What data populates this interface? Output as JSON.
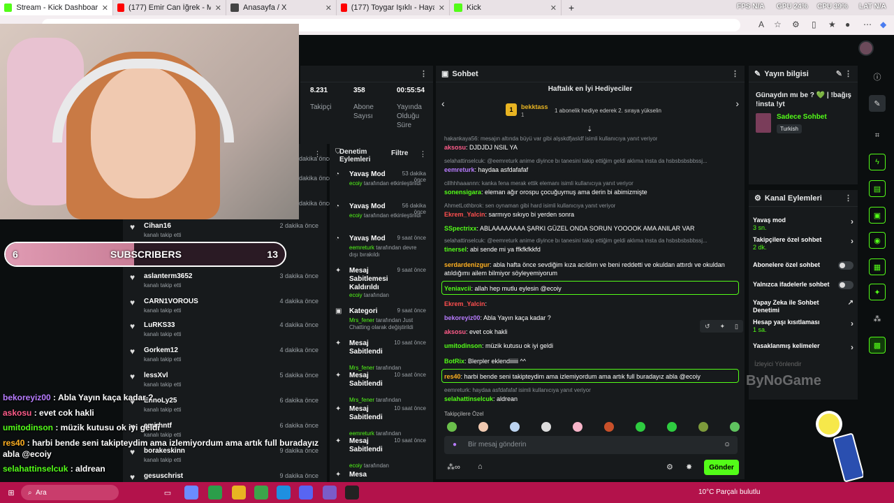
{
  "tabs": [
    {
      "label": "Stream - Kick Dashboard",
      "color": "#53fc18"
    },
    {
      "label": "(177) Emir Can İğrek - Müzik",
      "color": "#ff0000"
    },
    {
      "label": "Anasayfa / X",
      "color": "#444444"
    },
    {
      "label": "(177) Toygar Işıklı - Hayat Gibi (O",
      "color": "#ff0000"
    },
    {
      "label": "Kick",
      "color": "#53fc18"
    }
  ],
  "hud": {
    "fps": "FPS N/A",
    "gpu": "GPU 24%",
    "cpu": "CPU 39%",
    "lat": "LAT N/A"
  },
  "stats": [
    {
      "value": "8.231",
      "label": "Takipçi"
    },
    {
      "value": "358",
      "label": "Abone Sayısı"
    },
    {
      "value": "00:55:54",
      "label": "Yayında Olduğu Süre"
    }
  ],
  "subgoal": {
    "current": "6",
    "label": "SUBSCRIBERS",
    "target": "13",
    "progress": 0.46
  },
  "followers": [
    {
      "name": "Cihan16",
      "sub": "kanalı takip etti",
      "time": "2 dakika önce"
    },
    {
      "name": "aslanterm3652",
      "sub": "kanalı takip etti",
      "time": "3 dakika önce"
    },
    {
      "name": "CARN1VOROUS",
      "sub": "kanalı takip etti",
      "time": "4 dakika önce"
    },
    {
      "name": "LuRKS33",
      "sub": "kanalı takip etti",
      "time": "4 dakika önce"
    },
    {
      "name": "Gorkem12",
      "sub": "kanalı takip etti",
      "time": "4 dakika önce"
    },
    {
      "name": "lessXvl",
      "sub": "kanalı takip etti",
      "time": "5 dakika önce"
    },
    {
      "name": "EnnoLy25",
      "sub": "kanalı takip etti",
      "time": "6 dakika önce"
    },
    {
      "name": "emirhntf",
      "sub": "kanalı takip etti",
      "time": "6 dakika önce"
    },
    {
      "name": "borakeskinn",
      "sub": "kanalı takip etti",
      "time": "9 dakika önce"
    },
    {
      "name": "gesuschrist",
      "sub": "",
      "time": "9 dakika önce"
    }
  ],
  "follower_times_top": [
    "dakika önce",
    "dakika önce",
    "dakika önce"
  ],
  "overlay_chat": [
    {
      "user": "bekoreyiz00",
      "color": "#b87cff",
      "text": " : Abla Yayın kaça kadar ?"
    },
    {
      "user": "askosu",
      "color": "#ff5c8a",
      "text": " : evet cok hakli"
    },
    {
      "user": "umitodinson",
      "color": "#53fc18",
      "text": " : müzik kutusu ok iyi geldi"
    },
    {
      "user": "res40",
      "color": "#ffb020",
      "text": " : harbi bende seni takipteydim ama izlemiyordum ama artık full buradayız"
    },
    {
      "user": "",
      "color": "#ffffff",
      "text": "abla @ecoiy"
    },
    {
      "user": "selahattinselcuk",
      "color": "#53fc18",
      "text": " : aldrean"
    }
  ],
  "mod": {
    "title": "Denetim Eylemleri",
    "filter": "Filtre",
    "items": [
      {
        "title": "Yavaş Mod",
        "time": "53 dakika önce",
        "user": "ecoiy",
        "desc": " tarafından etkinleştirildi"
      },
      {
        "title": "Yavaş Mod",
        "time": "56 dakika önce",
        "user": "ecoiy",
        "desc": " tarafından etkinleştirildi"
      },
      {
        "title": "Yavaş Mod",
        "time": "9 saat önce",
        "user": "eemreturk",
        "desc": " tarafından devre dışı bırakıldı"
      },
      {
        "title": "Mesaj Sabitlemesi Kaldırıldı",
        "time": "9 saat önce",
        "user": "ecoiy",
        "desc": " tarafından"
      },
      {
        "title": "Kategori",
        "time": "9 saat önce",
        "user": "Mrs_fener",
        "desc": " tarafından Just Chatting olarak değiştirildi"
      },
      {
        "title": "Mesaj Sabitlendi",
        "time": "10 saat önce",
        "user": "Mrs_fener",
        "desc": " tarafından"
      },
      {
        "title": "Mesaj Sabitlendi",
        "time": "10 saat önce",
        "user": "Mrs_fener",
        "desc": " tarafından"
      },
      {
        "title": "Mesaj Sabitlendi",
        "time": "10 saat önce",
        "user": "eemreturk",
        "desc": " tarafından"
      },
      {
        "title": "Mesaj Sabitlendi",
        "time": "10 saat önce",
        "user": "ecoiy",
        "desc": " tarafından"
      },
      {
        "title": "Mesa",
        "time": "",
        "user": "",
        "desc": ""
      }
    ]
  },
  "chat": {
    "title": "Sohbet",
    "gifter_title": "Haftalık en İyi Hediyeciler",
    "gifter_name": "bekktass",
    "gifter_rank": "1",
    "gifter_count": "1",
    "gifter_note": "1 abonelik hediye ederek 2. sıraya yükselin",
    "messages": [
      {
        "reply": "hakankaya56: mesajın altında büyü var gibi alşskdfjasldf isimli kullanıcıya yanıt veriyor"
      },
      {
        "user": "aksosu",
        "color": "#ff5c8a",
        "text": ": DJDJDJ NSIL YA"
      },
      {
        "reply": "selahattinselcuk: @eemreturk anime diyince bı tanesini takip ettiğim geldi aklıma insta da hsbsbsbsbbssj..."
      },
      {
        "user": "eemreturk",
        "color": "#b87cff",
        "text": ": haydaa asfdafafaf"
      },
      {
        "reply": "cillhhhaaannn: kanka fena merak ettik elemanı isimli kullanıcıya yanıt veriyor"
      },
      {
        "user": "sonensigara",
        "color": "#53fc18",
        "text": ": eleman ağır orospu çocuğuymuş ama derin bi abimizmişte"
      },
      {
        "reply": "AhmetLothbrok: sen oynaman gibi hard isimli kullanıcıya yanıt veriyor"
      },
      {
        "user": "Ekrem_Yalcin",
        "color": "#ff4f4f",
        "text": ": sarmıyo sıkıyo bi yerden sonra"
      },
      {
        "user": "SSpectrixx",
        "color": "#53fc18",
        "text": ": ABLAAAAAAAA ŞARKI GÜZEL ONDA SORUN YOOOOK AMA ANILAR VAR"
      },
      {
        "reply": "selahattinselcuk: @eemreturk anime diyince bı tanesini takip ettiğim geldi aklıma insta da hsbsbsbsbbssj..."
      },
      {
        "user": "tinersel",
        "color": "#53fc18",
        "text": ": abi sende mi ya ffkfkfkkfd"
      },
      {
        "user": "serdardenizgur",
        "color": "#ffb020",
        "text": ": abla hafta önce sevdiğim kıza acıldım ve beni reddetti ve okuldan attırdı ve okuldan"
      },
      {
        "user": "",
        "color": "#ffffff",
        "text": "atıldığımı ailem bilmiyor söyleyemiyorum"
      },
      {
        "user": "Yeniavcii",
        "color": "#53fc18",
        "text": ": allah hep mutlu eylesin @ecoiy"
      },
      {
        "user": "Ekrem_Yalcin",
        "color": "#ff4f4f",
        "text": ":"
      },
      {
        "user": "bekoreyiz00",
        "color": "#b87cff",
        "text": ": Abla Yayın kaça kadar ?"
      },
      {
        "user": "aksosu",
        "color": "#ff5c8a",
        "text": ": evet cok hakli"
      },
      {
        "user": "umitodinson",
        "color": "#53fc18",
        "text": ": müzik kutusu ok iyi geldi"
      },
      {
        "user": "BotRix",
        "color": "#53fc18",
        "text": ": Blerpler eklendiiiiii ^^"
      },
      {
        "user": "res40",
        "color": "#ffb020",
        "text": ": harbi bende seni takipteydim ama izlemiyordum ama artık full buradayız abla @ecoiy"
      },
      {
        "reply": "eemreturk: haydaa asfdafafaf isimli kullanıcıya yanıt veriyor"
      },
      {
        "user": "selahattinselcuk",
        "color": "#53fc18",
        "text": ": aldrean"
      }
    ],
    "emote_label": "Takipçilere Özel",
    "input_placeholder": "Bir mesaj gönderin",
    "send_label": "Gönder"
  },
  "info": {
    "title": "Yayın bilgisi",
    "stream_title": "Günaydın mı be ? 💚 | !bağış !insta !yt",
    "category": "Sadece Sohbet",
    "language": "Turkish"
  },
  "channel_actions": {
    "title": "Kanal Eylemleri",
    "items": [
      {
        "label": "Yavaş mod",
        "sub": "3 sn.",
        "kind": "chev"
      },
      {
        "label": "Takipçilere özel sohbet",
        "sub": "2 dk.",
        "kind": "chev"
      },
      {
        "label": "Abonelere özel sohbet",
        "sub": "",
        "kind": "toggle"
      },
      {
        "label": "Yalnızca ifadelerle sohbet",
        "sub": "",
        "kind": "toggle"
      },
      {
        "label": "Yapay Zeka ile Sohbet Denetimi",
        "sub": "",
        "kind": "ext"
      },
      {
        "label": "Hesap yaşı kısıtlaması",
        "sub": "1 sa.",
        "kind": "chev"
      },
      {
        "label": "Yasaklanmış kelimeler",
        "sub": "",
        "kind": "chev"
      }
    ],
    "faded": "İzleyici Yönlendir",
    "watermark": "ByNoGame"
  },
  "taskbar": {
    "search": "Ara",
    "weather": "10°C  Parçalı bulutlu"
  }
}
